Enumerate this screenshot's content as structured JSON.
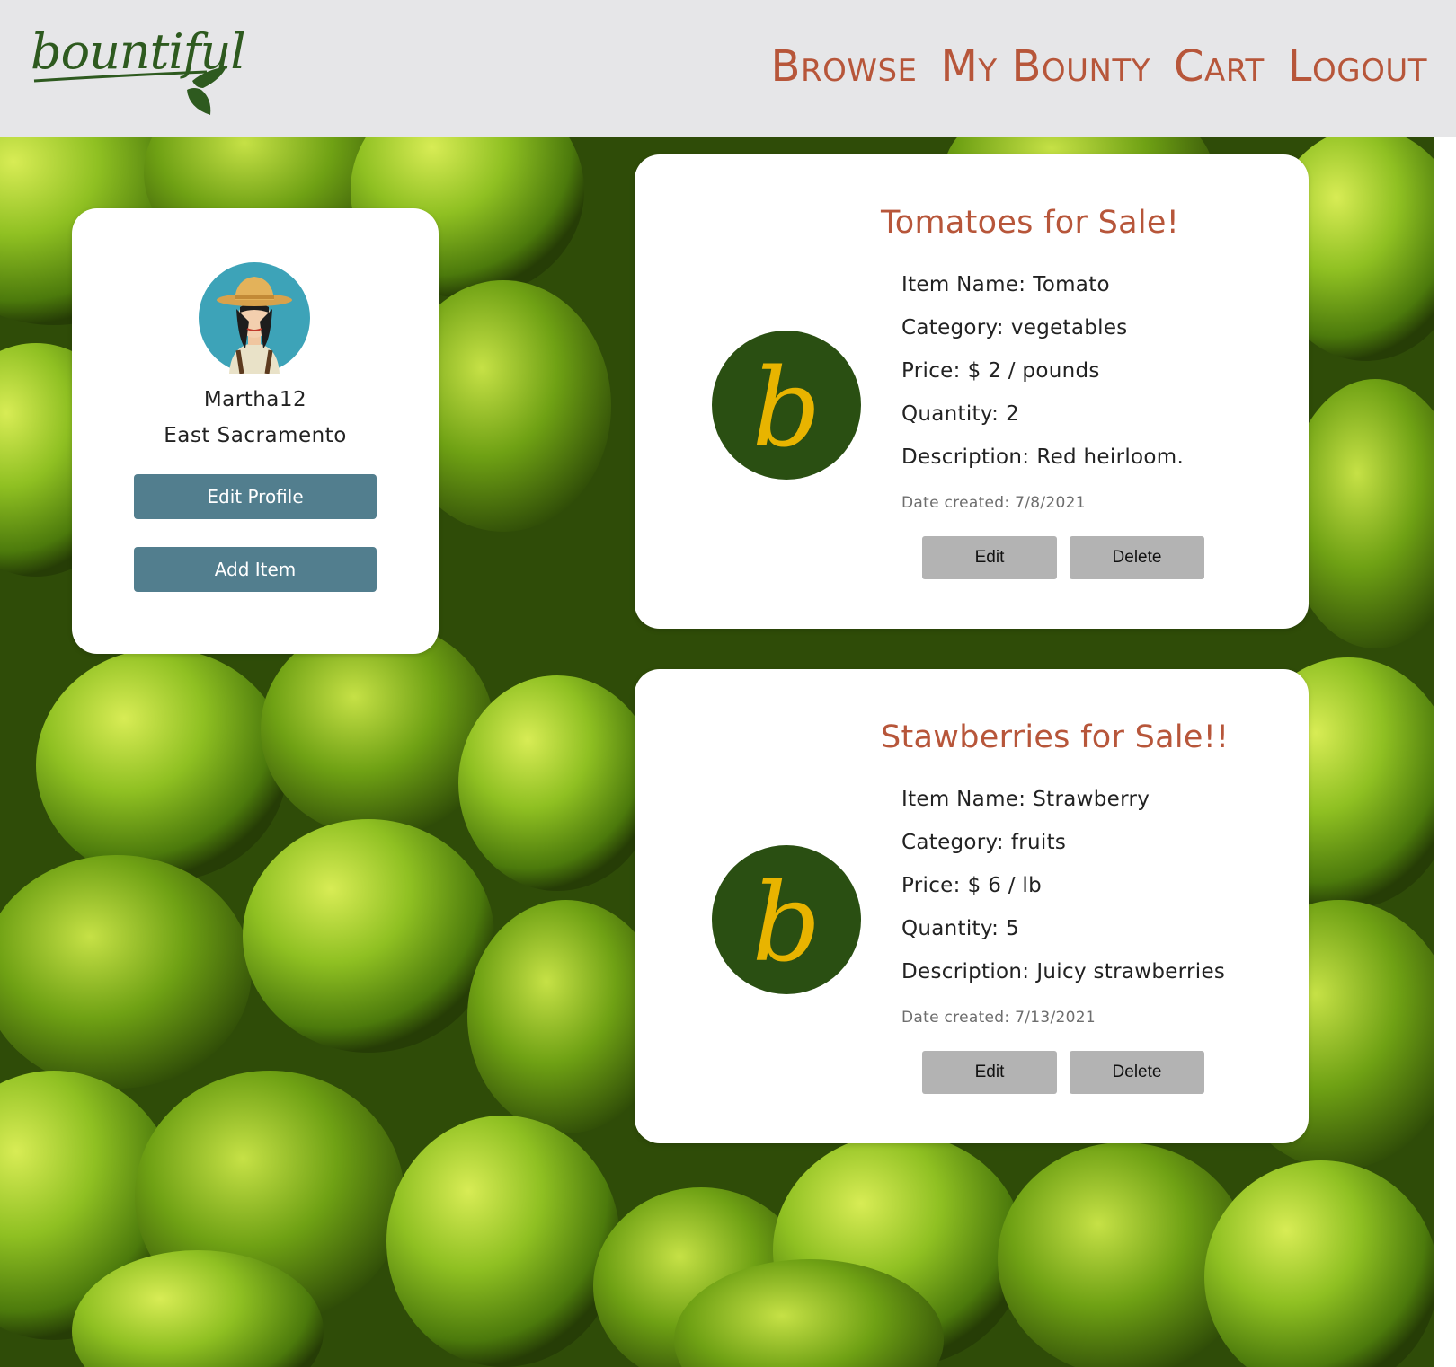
{
  "brand": {
    "logo_text": "bountiful"
  },
  "nav": {
    "browse": "Browse",
    "my_bounty": "My Bounty",
    "cart": "Cart",
    "logout": "Logout"
  },
  "profile": {
    "username": "Martha12",
    "location": "East Sacramento",
    "edit_profile_label": "Edit Profile",
    "add_item_label": "Add Item"
  },
  "items": [
    {
      "title": "Tomatoes for Sale!",
      "logo_letter": "b",
      "name_label": "Item Name:",
      "name": "Tomato",
      "category_label": "Category:",
      "category": "vegetables",
      "price_label": "Price:",
      "price": "$ 2 / pounds",
      "quantity_label": "Quantity:",
      "quantity": "2",
      "description_label": "Description:",
      "description": "Red heirloom.",
      "date_created": "Date created: 7/8/2021",
      "edit_label": "Edit",
      "delete_label": "Delete"
    },
    {
      "title": "Stawberries for Sale!!",
      "logo_letter": "b",
      "name_label": "Item Name:",
      "name": "Strawberry",
      "category_label": "Category:",
      "category": "fruits",
      "price_label": "Price:",
      "price": "$ 6 / lb",
      "quantity_label": "Quantity:",
      "quantity": "5",
      "description_label": "Description:",
      "description": "Juicy strawberries",
      "date_created": "Date created: 7/13/2021",
      "edit_label": "Edit",
      "delete_label": "Delete"
    }
  ],
  "colors": {
    "header_bg": "#e6e6e8",
    "nav_text": "#b7563a",
    "title_text": "#b7563a",
    "brand_green": "#2e5a1f",
    "button_blue": "#527e8e",
    "button_gray": "#b3b3b3",
    "logo_circle": "#2a4f12",
    "logo_letter": "#e8b400"
  },
  "icons": {
    "brand": "bountiful-leaf-logo",
    "avatar": "farmer-woman-avatar",
    "item_logo": "bountiful-b-logo"
  }
}
